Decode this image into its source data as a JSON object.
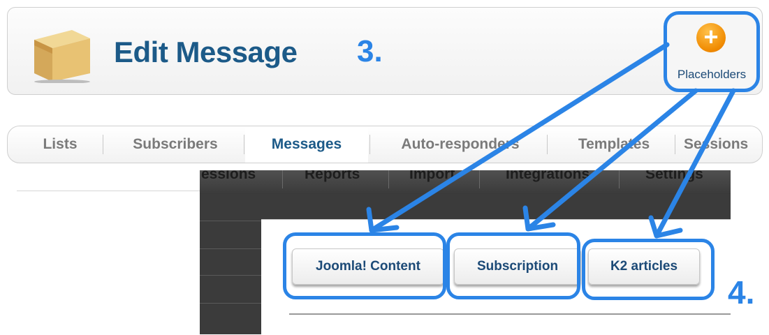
{
  "header": {
    "title": "Edit Message",
    "step_label": "3.",
    "placeholders_button": {
      "label": "Placeholders",
      "icon": "plus-circle-icon"
    }
  },
  "tabs": [
    {
      "label": "Lists",
      "active": false
    },
    {
      "label": "Subscribers",
      "active": false
    },
    {
      "label": "Messages",
      "active": true
    },
    {
      "label": "Auto-responders",
      "active": false
    },
    {
      "label": "Templates",
      "active": false
    },
    {
      "label": "Sessions",
      "active": false
    }
  ],
  "overlay_nav": [
    "essions",
    "Reports",
    "Import",
    "Integrations",
    "Settings"
  ],
  "placeholder_buttons": [
    {
      "label": "Joomla! Content"
    },
    {
      "label": "Subscription"
    },
    {
      "label": "K2 articles"
    }
  ],
  "step4_label": "4.",
  "colors": {
    "annotation": "#2b84e6",
    "title": "#1c5a88",
    "icon_orange": "#f08a00"
  }
}
